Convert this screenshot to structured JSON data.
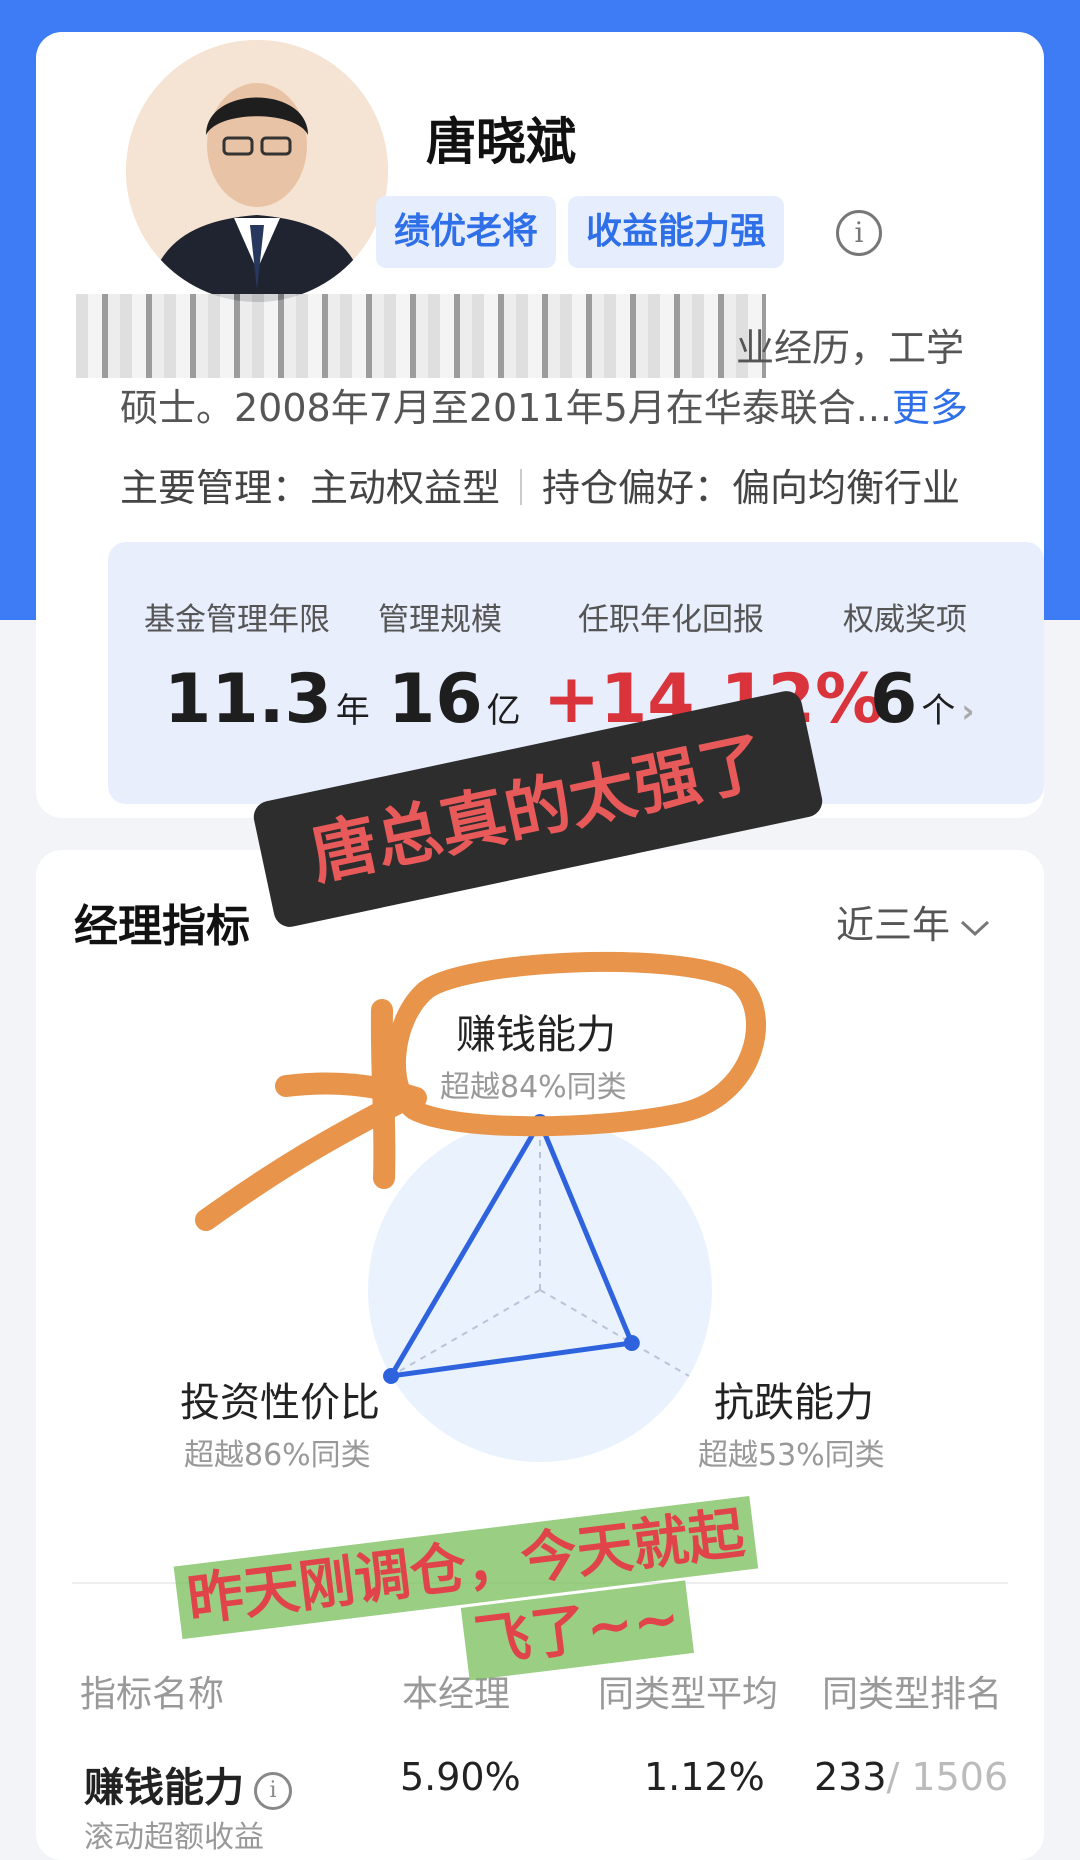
{
  "profile": {
    "name": "唐晓斌",
    "tags": [
      "绩优老将",
      "收益能力强"
    ],
    "bio_line1_visible": "业经历，工学",
    "bio_line2": "硕士。2008年7月至2011年5月在华泰联合...",
    "more_label": "更多",
    "management": "主要管理：主动权益型",
    "preference": "持仓偏好：偏向均衡行业"
  },
  "stats": [
    {
      "label": "基金管理年限",
      "value": "11.3",
      "unit": "年"
    },
    {
      "label": "管理规模",
      "value": "16",
      "unit": "亿"
    },
    {
      "label": "任职年化回报",
      "value": "+14.12%",
      "unit": ""
    },
    {
      "label": "权威奖项",
      "value": "6",
      "unit": "个"
    }
  ],
  "stickers": {
    "top": "唐总真的太强了",
    "bottom_line1": "昨天刚调仓，今天就起",
    "bottom_line2": "飞了~~"
  },
  "metrics": {
    "title": "经理指标",
    "period": "近三年",
    "radar": [
      {
        "name": "赚钱能力",
        "sub": "超越84%同类",
        "value": 84
      },
      {
        "name": "投资性价比",
        "sub": "超越86%同类",
        "value": 86
      },
      {
        "name": "抗跌能力",
        "sub": "超越53%同类",
        "value": 53
      }
    ],
    "table_headers": [
      "指标名称",
      "本经理",
      "同类型平均",
      "同类型排名"
    ],
    "row": {
      "name": "赚钱能力",
      "manager": "5.90%",
      "avg": "1.12%",
      "rank": "233",
      "rank_total": "/ 1506",
      "sub": "滚动超额收益"
    }
  },
  "colors": {
    "accent": "#3d7cf5",
    "positive": "#d9343c",
    "annotation": "#e8944a"
  }
}
